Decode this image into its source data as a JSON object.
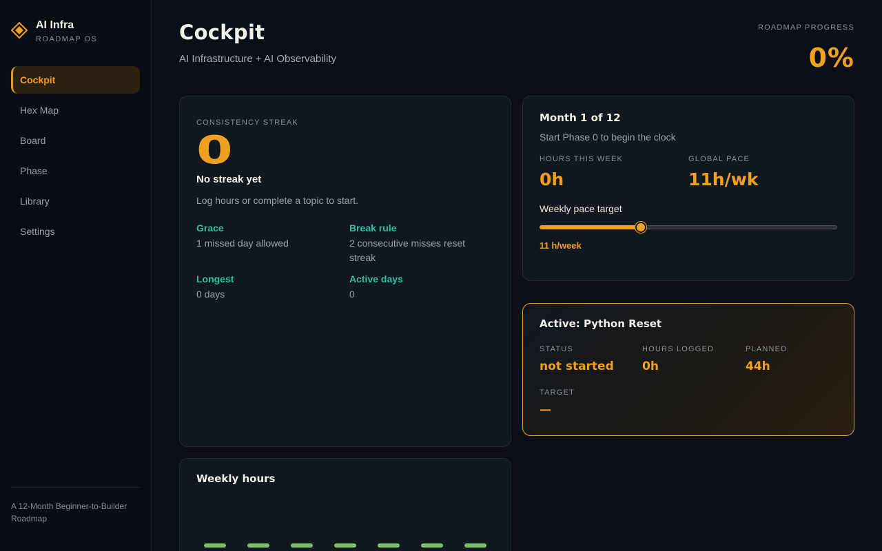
{
  "brand": {
    "title": "AI Infra",
    "subtitle": "ROADMAP OS",
    "icon": "diamond-logo-icon",
    "accent": "#f0a020"
  },
  "sidebar": {
    "items": [
      {
        "label": "Cockpit",
        "active": true
      },
      {
        "label": "Hex Map",
        "active": false
      },
      {
        "label": "Board",
        "active": false
      },
      {
        "label": "Phase",
        "active": false
      },
      {
        "label": "Library",
        "active": false
      },
      {
        "label": "Settings",
        "active": false
      }
    ],
    "footer": "A 12-Month Beginner-to-Builder Roadmap"
  },
  "header": {
    "title": "Cockpit",
    "subtitle": "AI Infrastructure + AI Observability",
    "progress_label": "ROADMAP PROGRESS",
    "progress_value": "0%"
  },
  "streak": {
    "label": "CONSISTENCY STREAK",
    "value": "0",
    "title": "No streak yet",
    "description": "Log hours or complete a topic to start.",
    "items": [
      {
        "key": "Grace",
        "value": "1 missed day allowed"
      },
      {
        "key": "Break rule",
        "value": "2 consecutive misses reset streak"
      },
      {
        "key": "Longest",
        "value": "0 days"
      },
      {
        "key": "Active days",
        "value": "0"
      }
    ]
  },
  "month": {
    "title": "Month 1 of 12",
    "subtitle": "Start Phase 0 to begin the clock",
    "hours_label": "HOURS THIS WEEK",
    "hours_value": "0h",
    "pace_label": "GLOBAL PACE",
    "pace_value": "11h/wk",
    "slider_label": "Weekly pace target",
    "slider_value_text": "11 h/week",
    "slider_fraction": 0.34
  },
  "active": {
    "title": "Active: Python Reset",
    "fields": [
      {
        "label": "STATUS",
        "value": "not started"
      },
      {
        "label": "HOURS LOGGED",
        "value": "0h"
      },
      {
        "label": "PLANNED",
        "value": "44h"
      },
      {
        "label": "TARGET",
        "value": "—"
      }
    ]
  },
  "weekly": {
    "title": "Weekly hours",
    "bar_count": 7,
    "bar_color": "#7fbf6a"
  }
}
